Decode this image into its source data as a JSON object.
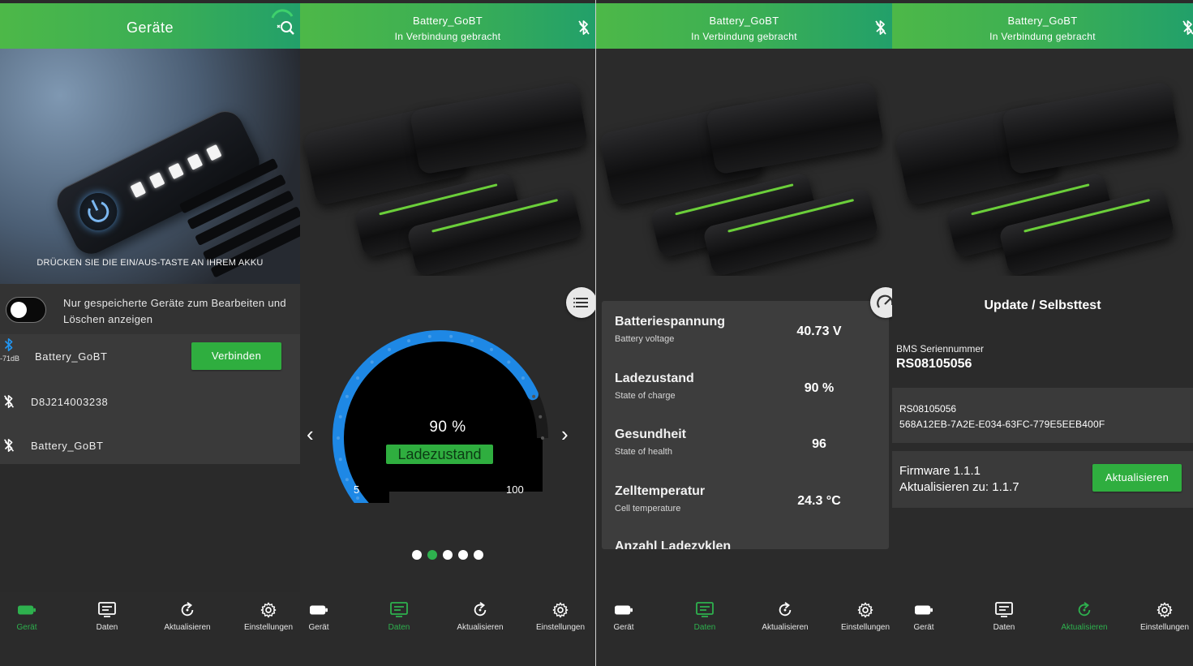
{
  "colors": {
    "accent": "#2eb14e",
    "button_green": "#2fae3f",
    "gauge_blue": "#1e88e5"
  },
  "nav": {
    "device": "Gerät",
    "data": "Daten",
    "update": "Aktualisieren",
    "settings": "Einstellungen"
  },
  "screen1": {
    "title": "Geräte",
    "hero_caption": "DRÜCKEN SIE DIE EIN/AUS-TASTE AN IHREM AKKU",
    "toggle_text": "Nur gespeicherte Geräte zum Bearbeiten und Löschen anzeigen",
    "toggle_on": false,
    "devices": [
      {
        "name": "Battery_GoBT",
        "rssi": "-71dB",
        "button": "Verbinden"
      },
      {
        "name": "D8J214003238"
      },
      {
        "name": "Battery_GoBT"
      }
    ]
  },
  "device_header": {
    "title": "Battery_GoBT",
    "status": "In Verbindung gebracht"
  },
  "screen2": {
    "gauge": {
      "value_text": "90 %",
      "label": "Ladezustand",
      "value": 90,
      "min_label": "5",
      "max_label": "100"
    },
    "page_count": 5,
    "active_page": 2
  },
  "screen3": {
    "rows": [
      {
        "label": "Batteriespannung",
        "sub": "Battery voltage",
        "value": "40.73 V"
      },
      {
        "label": "Ladezustand",
        "sub": "State of charge",
        "value": "90 %"
      },
      {
        "label": "Gesundheit",
        "sub": "State of health",
        "value": "96"
      },
      {
        "label": "Zelltemperatur",
        "sub": "Cell temperature",
        "value": "24.3 °C"
      },
      {
        "label": "Anzahl Ladezyklen",
        "sub": "",
        "value": ""
      }
    ]
  },
  "screen4": {
    "title": "Update / Selbsttest",
    "bms_label": "BMS Seriennummer",
    "bms_value": "RS08105056",
    "serial_line1": "RS08105056",
    "serial_line2": "568A12EB-7A2E-E034-63FC-779E5EEB400F",
    "firmware_line1": "Firmware 1.1.1",
    "firmware_line2": "Aktualisieren zu: 1.1.7",
    "button": "Aktualisieren"
  }
}
